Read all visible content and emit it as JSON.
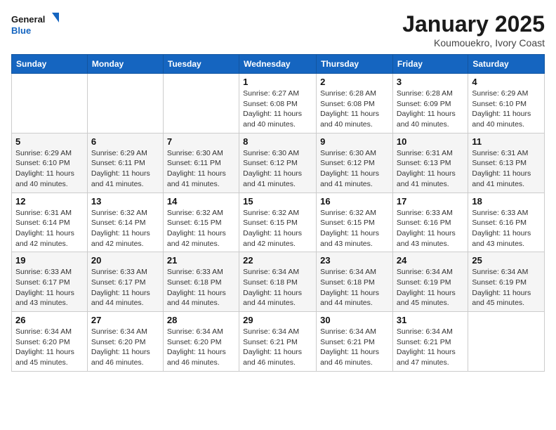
{
  "logo": {
    "line1": "General",
    "line2": "Blue"
  },
  "header": {
    "month": "January 2025",
    "location": "Koumouekro, Ivory Coast"
  },
  "weekdays": [
    "Sunday",
    "Monday",
    "Tuesday",
    "Wednesday",
    "Thursday",
    "Friday",
    "Saturday"
  ],
  "weeks": [
    [
      {
        "day": "",
        "info": ""
      },
      {
        "day": "",
        "info": ""
      },
      {
        "day": "",
        "info": ""
      },
      {
        "day": "1",
        "info": "Sunrise: 6:27 AM\nSunset: 6:08 PM\nDaylight: 11 hours and 40 minutes."
      },
      {
        "day": "2",
        "info": "Sunrise: 6:28 AM\nSunset: 6:08 PM\nDaylight: 11 hours and 40 minutes."
      },
      {
        "day": "3",
        "info": "Sunrise: 6:28 AM\nSunset: 6:09 PM\nDaylight: 11 hours and 40 minutes."
      },
      {
        "day": "4",
        "info": "Sunrise: 6:29 AM\nSunset: 6:10 PM\nDaylight: 11 hours and 40 minutes."
      }
    ],
    [
      {
        "day": "5",
        "info": "Sunrise: 6:29 AM\nSunset: 6:10 PM\nDaylight: 11 hours and 40 minutes."
      },
      {
        "day": "6",
        "info": "Sunrise: 6:29 AM\nSunset: 6:11 PM\nDaylight: 11 hours and 41 minutes."
      },
      {
        "day": "7",
        "info": "Sunrise: 6:30 AM\nSunset: 6:11 PM\nDaylight: 11 hours and 41 minutes."
      },
      {
        "day": "8",
        "info": "Sunrise: 6:30 AM\nSunset: 6:12 PM\nDaylight: 11 hours and 41 minutes."
      },
      {
        "day": "9",
        "info": "Sunrise: 6:30 AM\nSunset: 6:12 PM\nDaylight: 11 hours and 41 minutes."
      },
      {
        "day": "10",
        "info": "Sunrise: 6:31 AM\nSunset: 6:13 PM\nDaylight: 11 hours and 41 minutes."
      },
      {
        "day": "11",
        "info": "Sunrise: 6:31 AM\nSunset: 6:13 PM\nDaylight: 11 hours and 41 minutes."
      }
    ],
    [
      {
        "day": "12",
        "info": "Sunrise: 6:31 AM\nSunset: 6:14 PM\nDaylight: 11 hours and 42 minutes."
      },
      {
        "day": "13",
        "info": "Sunrise: 6:32 AM\nSunset: 6:14 PM\nDaylight: 11 hours and 42 minutes."
      },
      {
        "day": "14",
        "info": "Sunrise: 6:32 AM\nSunset: 6:15 PM\nDaylight: 11 hours and 42 minutes."
      },
      {
        "day": "15",
        "info": "Sunrise: 6:32 AM\nSunset: 6:15 PM\nDaylight: 11 hours and 42 minutes."
      },
      {
        "day": "16",
        "info": "Sunrise: 6:32 AM\nSunset: 6:15 PM\nDaylight: 11 hours and 43 minutes."
      },
      {
        "day": "17",
        "info": "Sunrise: 6:33 AM\nSunset: 6:16 PM\nDaylight: 11 hours and 43 minutes."
      },
      {
        "day": "18",
        "info": "Sunrise: 6:33 AM\nSunset: 6:16 PM\nDaylight: 11 hours and 43 minutes."
      }
    ],
    [
      {
        "day": "19",
        "info": "Sunrise: 6:33 AM\nSunset: 6:17 PM\nDaylight: 11 hours and 43 minutes."
      },
      {
        "day": "20",
        "info": "Sunrise: 6:33 AM\nSunset: 6:17 PM\nDaylight: 11 hours and 44 minutes."
      },
      {
        "day": "21",
        "info": "Sunrise: 6:33 AM\nSunset: 6:18 PM\nDaylight: 11 hours and 44 minutes."
      },
      {
        "day": "22",
        "info": "Sunrise: 6:34 AM\nSunset: 6:18 PM\nDaylight: 11 hours and 44 minutes."
      },
      {
        "day": "23",
        "info": "Sunrise: 6:34 AM\nSunset: 6:18 PM\nDaylight: 11 hours and 44 minutes."
      },
      {
        "day": "24",
        "info": "Sunrise: 6:34 AM\nSunset: 6:19 PM\nDaylight: 11 hours and 45 minutes."
      },
      {
        "day": "25",
        "info": "Sunrise: 6:34 AM\nSunset: 6:19 PM\nDaylight: 11 hours and 45 minutes."
      }
    ],
    [
      {
        "day": "26",
        "info": "Sunrise: 6:34 AM\nSunset: 6:20 PM\nDaylight: 11 hours and 45 minutes."
      },
      {
        "day": "27",
        "info": "Sunrise: 6:34 AM\nSunset: 6:20 PM\nDaylight: 11 hours and 46 minutes."
      },
      {
        "day": "28",
        "info": "Sunrise: 6:34 AM\nSunset: 6:20 PM\nDaylight: 11 hours and 46 minutes."
      },
      {
        "day": "29",
        "info": "Sunrise: 6:34 AM\nSunset: 6:21 PM\nDaylight: 11 hours and 46 minutes."
      },
      {
        "day": "30",
        "info": "Sunrise: 6:34 AM\nSunset: 6:21 PM\nDaylight: 11 hours and 46 minutes."
      },
      {
        "day": "31",
        "info": "Sunrise: 6:34 AM\nSunset: 6:21 PM\nDaylight: 11 hours and 47 minutes."
      },
      {
        "day": "",
        "info": ""
      }
    ]
  ]
}
